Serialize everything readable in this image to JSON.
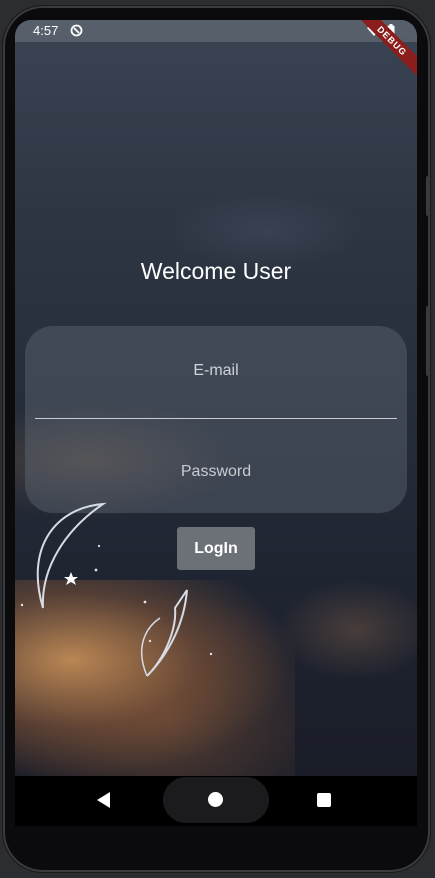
{
  "status_bar": {
    "time": "4:57",
    "debug_banner": "DEBUG"
  },
  "login": {
    "title": "Welcome User",
    "email_placeholder": "E-mail",
    "password_placeholder": "Password",
    "button_label": "LogIn"
  },
  "colors": {
    "button_bg": "#6c7077",
    "card_bg": "rgba(110,120,135,0.35)",
    "debug_banner": "#8b1d1d"
  },
  "icons": {
    "status_app": "sync-circle-icon",
    "wifi": "wifi-icon",
    "battery": "battery-icon",
    "nav_back": "back-triangle-icon",
    "nav_home": "home-circle-icon",
    "nav_recents": "recents-square-icon"
  }
}
